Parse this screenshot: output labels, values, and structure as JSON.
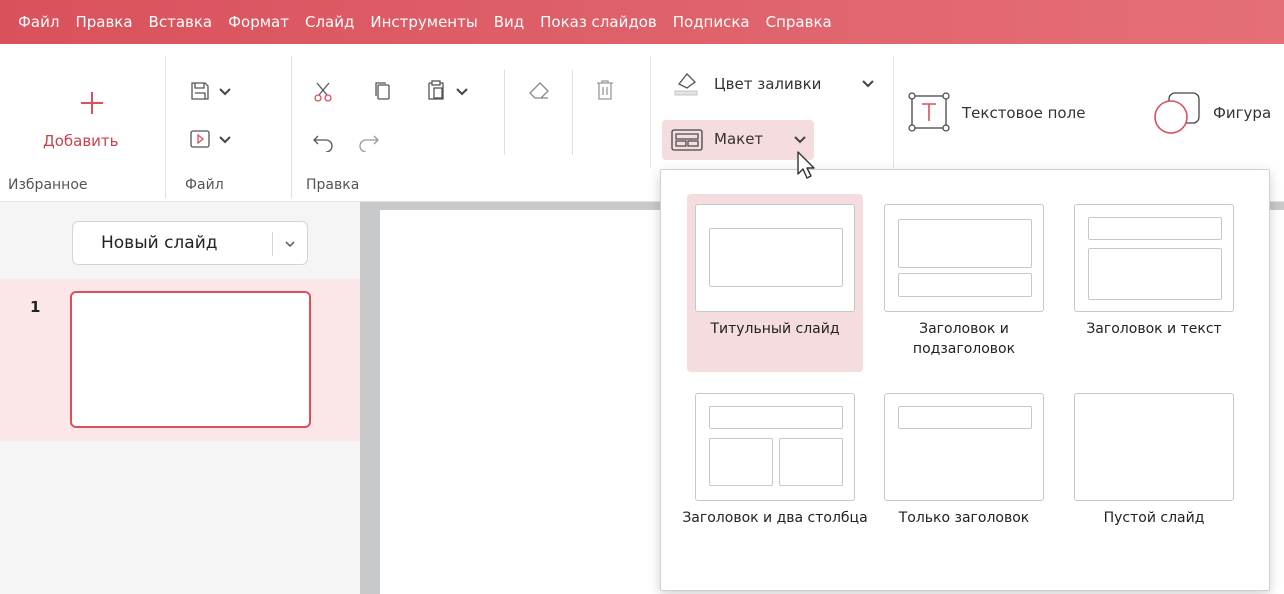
{
  "menu": {
    "items": [
      "Файл",
      "Правка",
      "Вставка",
      "Формат",
      "Слайд",
      "Инструменты",
      "Вид",
      "Показ слайдов",
      "Подписка",
      "Справка"
    ]
  },
  "ribbon": {
    "favorites": {
      "add_label": "Добавить",
      "group_label": "Избранное"
    },
    "file": {
      "group_label": "Файл"
    },
    "edit": {
      "group_label": "Правка"
    },
    "fill_color_label": "Цвет заливки",
    "layout_label": "Макет",
    "text_box_label": "Текстовое поле",
    "shape_label": "Фигура"
  },
  "slides_panel": {
    "new_slide_label": "Новый слайд",
    "slides": [
      {
        "number": "1"
      }
    ]
  },
  "layout_menu": {
    "selected_index": 0,
    "items": [
      {
        "label": "Титульный слайд"
      },
      {
        "label": "Заголовок и подзаголовок"
      },
      {
        "label": "Заголовок и текст"
      },
      {
        "label": "Заголовок и два столбца"
      },
      {
        "label": "Только заголовок"
      },
      {
        "label": "Пустой слайд"
      }
    ]
  },
  "colors": {
    "accent": "#d9515b",
    "selection": "#f4dcdf",
    "slide_row": "#fbe6e8"
  },
  "icons": [
    "plus-icon",
    "save-icon",
    "slideshow-icon",
    "cut-icon",
    "copy-icon",
    "paste-icon",
    "clear-format-icon",
    "delete-icon",
    "undo-icon",
    "redo-icon",
    "fill-color-icon",
    "layout-icon",
    "text-box-icon",
    "shape-icon",
    "chevron-down-icon",
    "mouse-cursor-icon"
  ]
}
